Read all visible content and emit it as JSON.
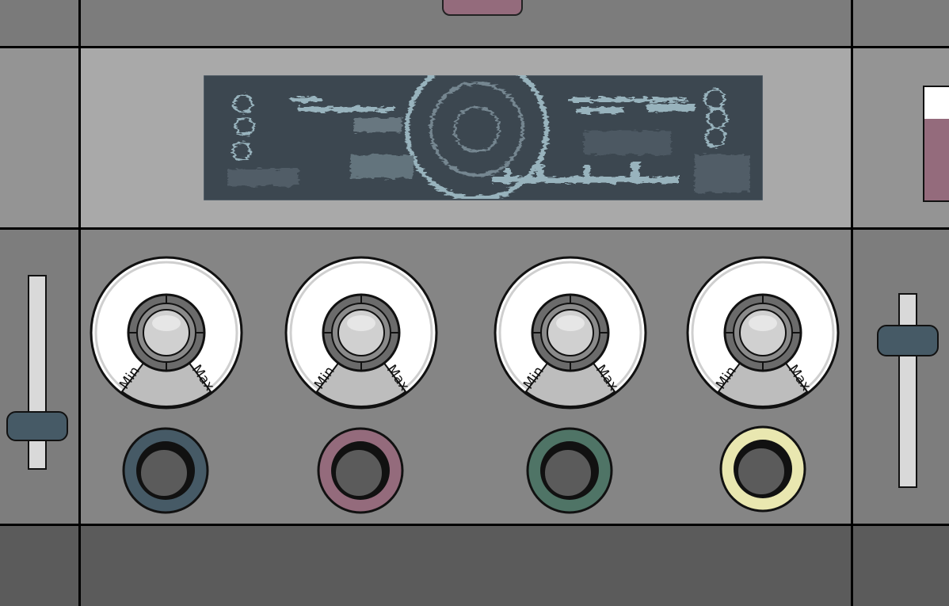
{
  "module": {
    "colors": {
      "panel_top": "#7c7c7c",
      "panel_display": "#a9a9a9",
      "panel_controls": "#858585",
      "panel_bottom": "#5b5b5b",
      "side_column": "#7d7d7d",
      "display_bg": "#3c4750",
      "display_glitch": "#a9c6d0",
      "slider_thumb": "#465a66",
      "accent_pink": "#946b7c"
    },
    "meter": {
      "level_fraction": 0.72
    },
    "left_fader": {
      "level_fraction": 0.18
    },
    "right_fader": {
      "level_fraction": 0.8
    },
    "knobs": [
      {
        "min_label": "Min",
        "max_label": "Max"
      },
      {
        "min_label": "Min",
        "max_label": "Max"
      },
      {
        "min_label": "Min",
        "max_label": "Max"
      },
      {
        "min_label": "Min",
        "max_label": "Max"
      }
    ],
    "jacks": [
      {
        "ring_color": "#465a66"
      },
      {
        "ring_color": "#946b7c"
      },
      {
        "ring_color": "#4f7466"
      },
      {
        "ring_color": "#e9e7b0"
      }
    ]
  }
}
